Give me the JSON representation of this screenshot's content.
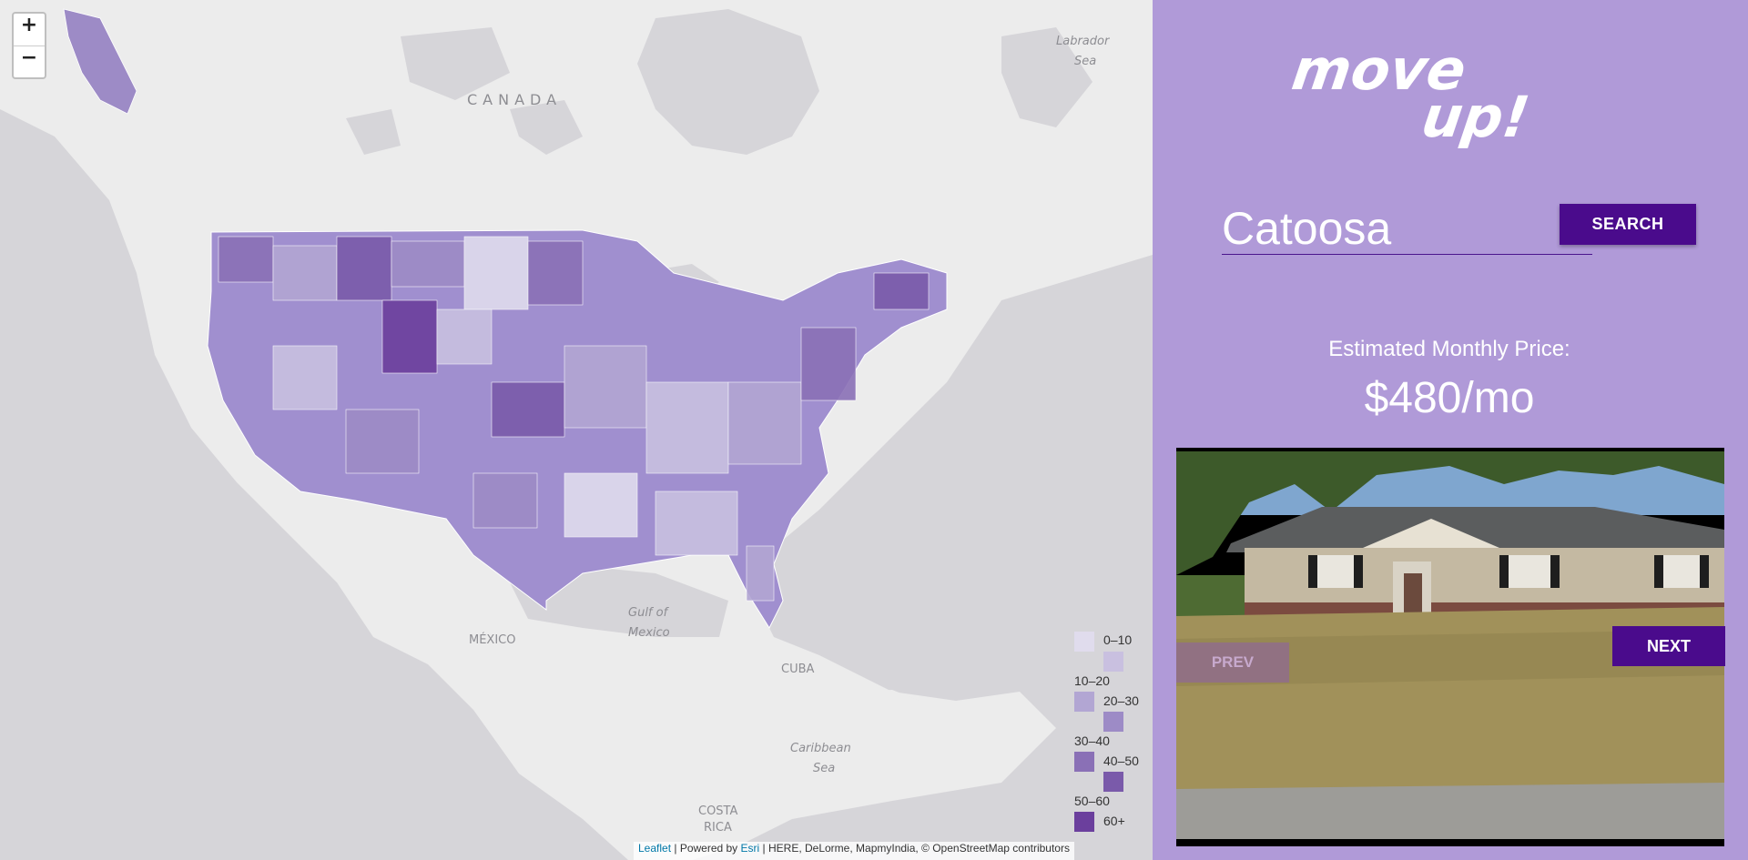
{
  "map": {
    "zoom_in": "+",
    "zoom_out": "−",
    "labels": {
      "canada": "CANADA",
      "labrador_line1": "Labrador",
      "labrador_line2": "Sea",
      "gulf_line1": "Gulf of",
      "gulf_line2": "Mexico",
      "mexico": "MÉXICO",
      "cuba": "CUBA",
      "caribbean_line1": "Caribbean",
      "caribbean_line2": "Sea",
      "costa_line1": "COSTA",
      "costa_line2": "RICA"
    },
    "legend": [
      {
        "label": "0–10",
        "color": "#e0dced"
      },
      {
        "label": "10–20",
        "color": "#c9c0e0"
      },
      {
        "label": "20–30",
        "color": "#b2a6d3"
      },
      {
        "label": "30–40",
        "color": "#9d8bc6"
      },
      {
        "label": "40–50",
        "color": "#8a70b6"
      },
      {
        "label": "50–60",
        "color": "#7a5aaa"
      },
      {
        "label": "60+",
        "color": "#6b3f9d"
      }
    ],
    "attribution": {
      "leaflet": "Leaflet",
      "powered": " | Powered by ",
      "esri": "Esri",
      "rest": " | HERE, DeLorme, MapmyIndia, © OpenStreetMap contributors"
    }
  },
  "panel": {
    "logo_line1": "move",
    "logo_line2": "up!",
    "search_value": "Catoosa",
    "search_label": "SEARCH",
    "estimate_label": "Estimated Monthly Price:",
    "price": "$480/mo",
    "prev_label": "PREV",
    "next_label": "NEXT"
  },
  "colors": {
    "panel_bg": "#b09ad8",
    "button": "#4a0b8c",
    "map_ocean": "#d6d5d9",
    "map_land": "#ececec"
  }
}
